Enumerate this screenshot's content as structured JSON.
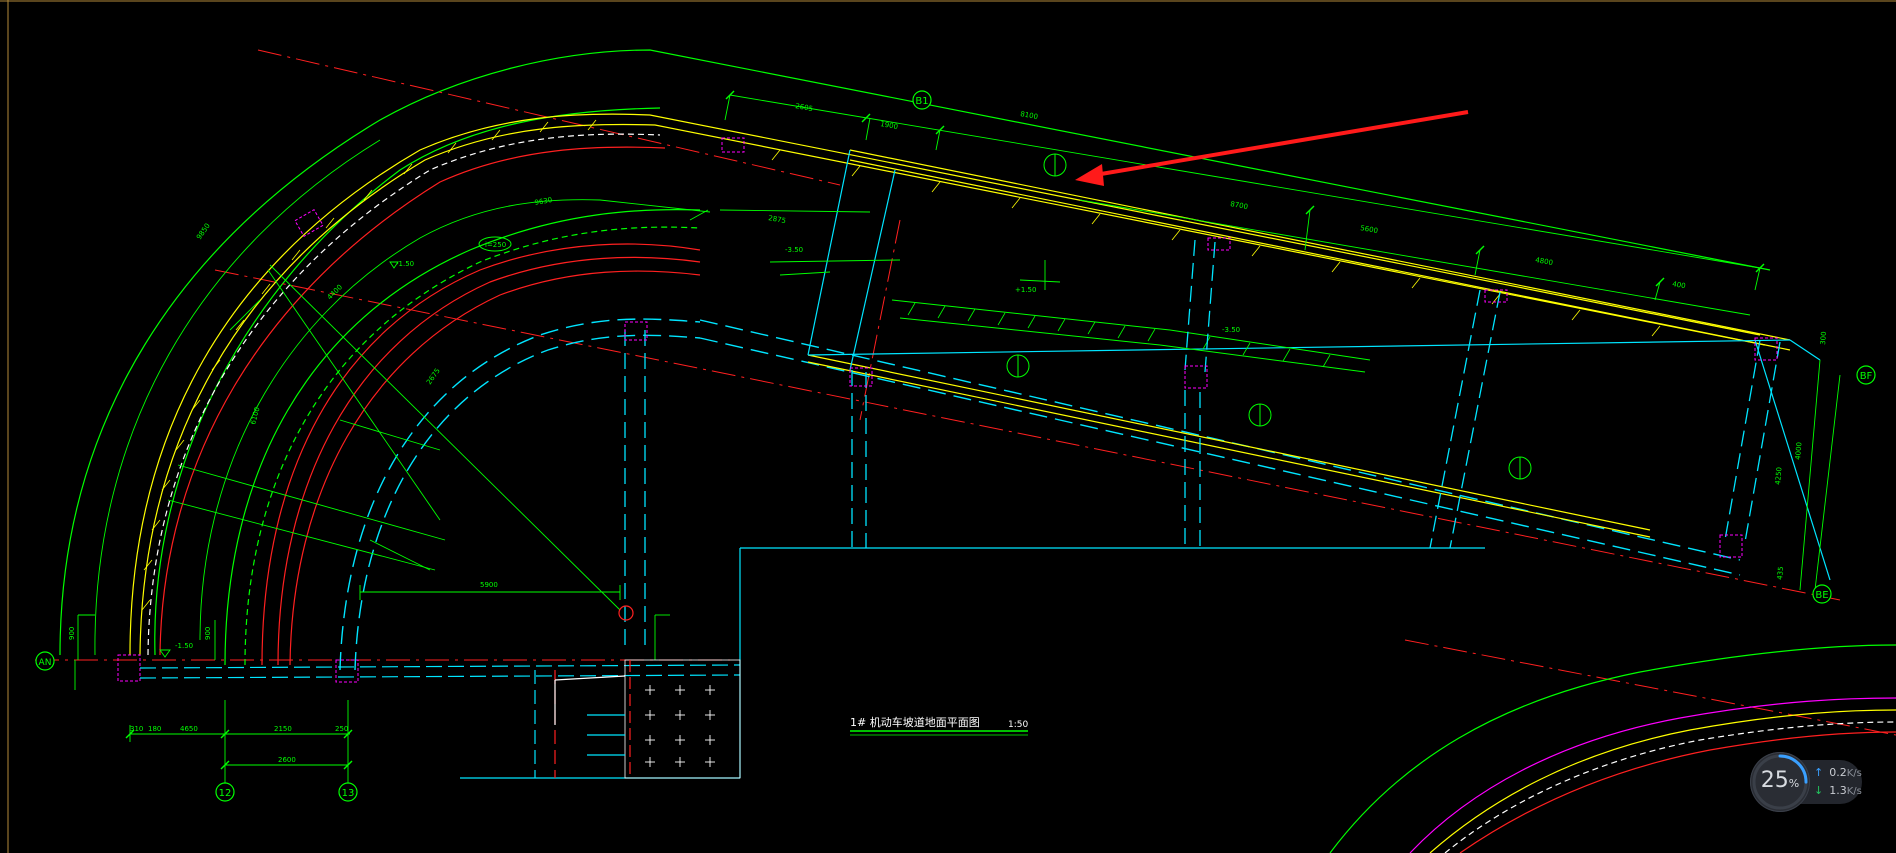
{
  "colors": {
    "background": "#000000",
    "green": "#00ff00",
    "cyan": "#00e5ff",
    "red": "#ff2020",
    "yellow": "#ffff00",
    "white": "#ffffff",
    "magenta": "#ff00ff",
    "annotation_arrow": "#ff1a1a"
  },
  "grid_bubbles": {
    "b1": "B1",
    "bf": "BF",
    "be": "BE",
    "an": "AN",
    "col12": "12",
    "col13": "13"
  },
  "dimensions": {
    "top_2605": "2605",
    "top_1900": "1900",
    "top_8100": "8100",
    "mid_5600": "5600",
    "mid_4800": "4800",
    "mid_400": "400",
    "mid_8700": "8700",
    "left_9850": "9850",
    "left_6100": "6100",
    "left_4400": "4400",
    "left_2675": "2675",
    "left_9630": "9630",
    "left_2875": "2875",
    "right_4000": "4000",
    "right_4250": "4250",
    "right_300": "300",
    "right_435": "435",
    "h_5900": "5900",
    "b_2150": "2150",
    "b_2600": "2600",
    "b_250": "250",
    "b_900": "900",
    "b_310": "310",
    "b_180": "180",
    "b_4650": "4650",
    "l_900": "900"
  },
  "levels": {
    "minus_150": "-1.50",
    "minus_150_b": "-1.50",
    "minus_350": "-3.50",
    "minus_350_b": "-3.50",
    "plus_150": "+1.50",
    "slope_label": "i=250"
  },
  "drawing_title": {
    "name": "1# 机动车坡道地面平面图",
    "scale": "1:50"
  },
  "net_widget": {
    "percent": "25",
    "percent_sign": "%",
    "up_value": "0.2",
    "down_value": "1.3",
    "unit": "K/s"
  }
}
